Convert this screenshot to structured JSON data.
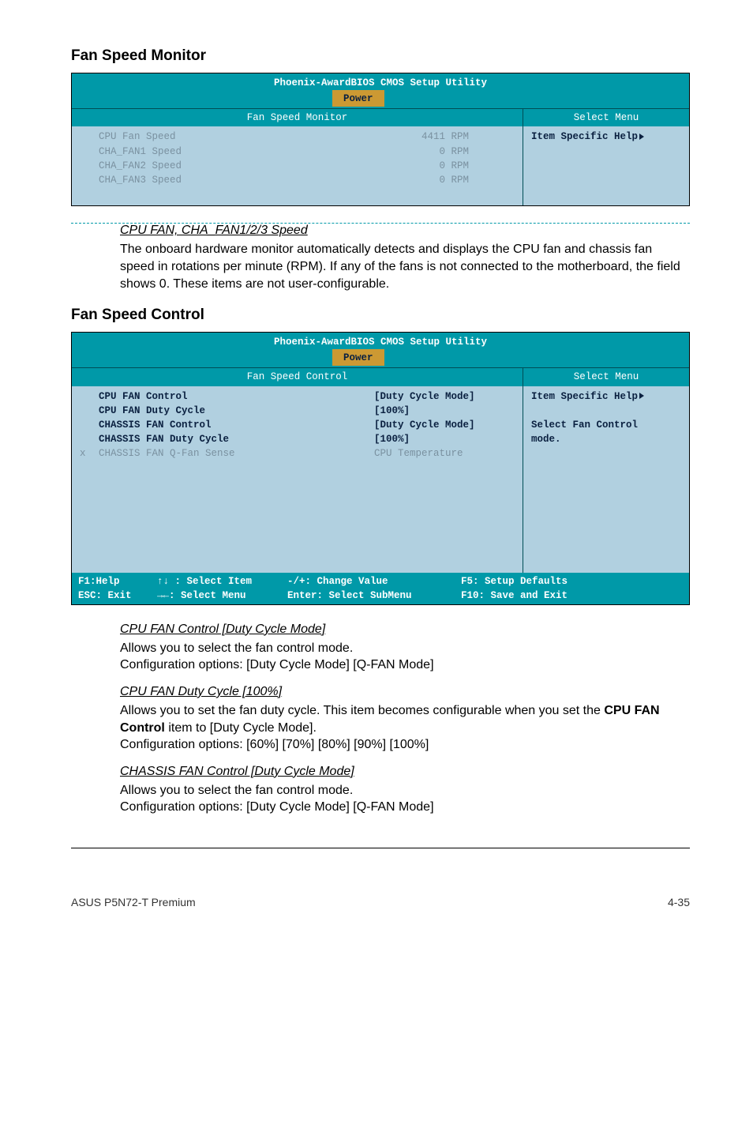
{
  "headings": {
    "fan_speed_monitor": "Fan Speed Monitor",
    "fan_speed_control": "Fan Speed Control"
  },
  "bios1": {
    "title": "Phoenix-AwardBIOS CMOS Setup Utility",
    "tab": "Power",
    "left_header": "Fan Speed Monitor",
    "right_header": "Select Menu",
    "help": "Item Specific Help",
    "rows": [
      {
        "label": "CPU Fan Speed",
        "value": "4411 RPM"
      },
      {
        "label": "CHA_FAN1 Speed",
        "value": "0 RPM"
      },
      {
        "label": "CHA_FAN2 Speed",
        "value": "0 RPM"
      },
      {
        "label": "CHA_FAN3 Speed",
        "value": "0 RPM"
      }
    ]
  },
  "block_cpu_cha": {
    "title": "CPU FAN, CHA_FAN1/2/3 Speed",
    "text": "The onboard hardware monitor automatically detects and displays the CPU fan and chassis fan speed in rotations per minute (RPM). If any of the fans is not connected to the motherboard, the field shows 0. These items are not user-configurable."
  },
  "bios2": {
    "title": "Phoenix-AwardBIOS CMOS Setup Utility",
    "tab": "Power",
    "left_header": "Fan Speed Control",
    "right_header": "Select Menu",
    "help_line1": "Item Specific Help",
    "help_line2": "Select Fan Control",
    "help_line3": "mode.",
    "rows": [
      {
        "prefix": "",
        "label": "CPU FAN Control",
        "value": "[Duty Cycle Mode]"
      },
      {
        "prefix": "",
        "label": "CPU FAN Duty Cycle",
        "value": "[100%]"
      },
      {
        "prefix": "",
        "label": "CHASSIS FAN Control",
        "value": "[Duty Cycle Mode]"
      },
      {
        "prefix": "",
        "label": "CHASSIS FAN Duty Cycle",
        "value": "[100%]"
      },
      {
        "prefix": "x",
        "label": "CHASSIS FAN Q-Fan Sense",
        "value": "CPU Temperature"
      }
    ],
    "footer": {
      "c1a": "F1:Help",
      "c2a": "↑↓ : Select Item",
      "c3a": "-/+: Change Value",
      "c4a": "F5: Setup Defaults",
      "c1b": "ESC: Exit",
      "c2b": "→←: Select Menu",
      "c3b": "Enter: Select SubMenu",
      "c4b": "F10: Save and Exit"
    }
  },
  "block_cpufan_control": {
    "title": "CPU FAN Control [Duty Cycle Mode]",
    "line1": "Allows you to select the fan control mode.",
    "line2": "Configuration options: [Duty Cycle Mode] [Q-FAN Mode]"
  },
  "block_cpufan_duty": {
    "title": "CPU FAN Duty Cycle [100%]",
    "line1_a": "Allows you to set the fan duty cycle. This item becomes configurable when you set the ",
    "line1_bold": "CPU FAN Control",
    "line1_b": " item to [Duty Cycle Mode].",
    "line2": "Configuration options: [60%] [70%] [80%] [90%] [100%]"
  },
  "block_chassis_control": {
    "title": "CHASSIS FAN Control [Duty Cycle Mode]",
    "line1": "Allows you to select the fan control mode.",
    "line2": "Configuration options: [Duty Cycle Mode] [Q-FAN Mode]"
  },
  "footer": {
    "product": "ASUS P5N72-T Premium",
    "page": "4-35"
  }
}
